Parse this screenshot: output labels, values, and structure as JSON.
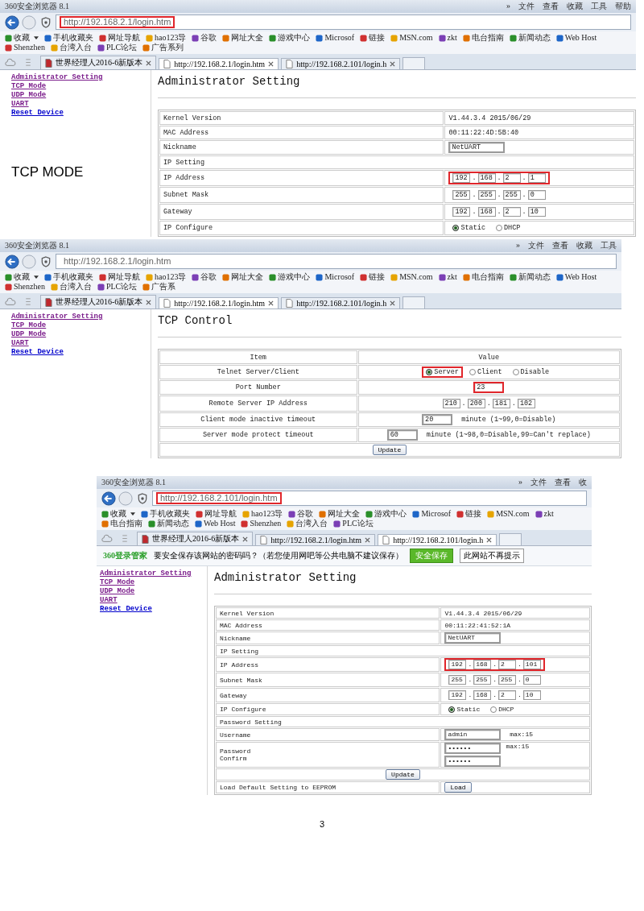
{
  "panels": [
    {
      "browser": {
        "title": "360安全浏览器 8.1",
        "menu": [
          "»",
          "文件",
          "查看",
          "收藏",
          "工具",
          "帮助"
        ],
        "url": "http://192.168.2.1/login.htm",
        "url_highlighted": true,
        "bookmarks": [
          "收藏",
          "手机收藏夹",
          "网址导航",
          "hao123导",
          "谷歌",
          "网址大全",
          "游戏中心",
          "Microsof",
          "链接",
          "MSN.com",
          "zkt",
          "电台指南",
          "新闻动态",
          "Web Host",
          "Shenzhen",
          "台湾入台",
          "PLC论坛",
          "广告系列"
        ],
        "tabs": [
          {
            "label": "世界经理人2016-6新版本",
            "selected": false
          },
          {
            "label": "http://192.168.2.1/login.htm",
            "selected": true
          },
          {
            "label": "http://192.168.2.101/login.h",
            "selected": false
          }
        ]
      },
      "sidebar": [
        {
          "label": "Administrator Setting",
          "visited": true
        },
        {
          "label": "TCP Mode",
          "visited": true
        },
        {
          "label": "UDP Mode",
          "visited": true
        },
        {
          "label": "UART",
          "visited": true
        },
        {
          "label": "Reset Device",
          "visited": false
        }
      ],
      "caption": "TCP MODE",
      "page": {
        "title": "Administrator Setting",
        "rows": [
          {
            "kind": "text",
            "label": "Kernel Version",
            "value": "V1.44.3.4 2015/06/29"
          },
          {
            "kind": "text",
            "label": "MAC Address",
            "value": "00:11:22:4D:5B:40"
          },
          {
            "kind": "input",
            "label": "Nickname",
            "value": "NetUART"
          },
          {
            "kind": "section",
            "label": "IP Setting"
          },
          {
            "kind": "ip",
            "label": "IP Address",
            "octets": [
              "192",
              "168",
              "2",
              "1"
            ],
            "separator": ".",
            "highlighted": true
          },
          {
            "kind": "ip",
            "label": "Subnet Mask",
            "octets": [
              "255",
              "255",
              "255",
              "0"
            ],
            "separator": ".",
            "highlighted": false
          },
          {
            "kind": "ip",
            "label": "Gateway",
            "octets": [
              "192",
              "168",
              "2",
              "10"
            ],
            "separator": ".",
            "highlighted": false
          },
          {
            "kind": "radio",
            "label": "IP Configure",
            "options": [
              {
                "label": "Static",
                "selected": true,
                "highlighted": false
              },
              {
                "label": "DHCP",
                "selected": false,
                "highlighted": false
              }
            ]
          }
        ]
      }
    },
    {
      "browser": {
        "title": "360安全浏览器 8.1",
        "menu": [
          "»",
          "文件",
          "查看",
          "收藏",
          "工具"
        ],
        "url": "http://192.168.2.1/login.htm",
        "url_highlighted": false,
        "bookmarks": [
          "收藏",
          "手机收藏夹",
          "网址导航",
          "hao123导",
          "谷歌",
          "网址大全",
          "游戏中心",
          "Microsof",
          "链接",
          "MSN.com",
          "zkt",
          "电台指南",
          "新闻动态",
          "Web Host",
          "Shenzhen",
          "台湾入台",
          "PLC论坛",
          "广告系"
        ],
        "tabs": [
          {
            "label": "世界经理人2016-6新版本",
            "selected": false
          },
          {
            "label": "http://192.168.2.1/login.htm",
            "selected": true
          },
          {
            "label": "http://192.168.2.101/login.h",
            "selected": false
          }
        ]
      },
      "sidebar": [
        {
          "label": "Administrator Setting",
          "visited": true
        },
        {
          "label": "TCP Mode",
          "visited": true
        },
        {
          "label": "UDP Mode",
          "visited": true
        },
        {
          "label": "UART",
          "visited": true
        },
        {
          "label": "Reset Device",
          "visited": false
        }
      ],
      "page": {
        "title": "TCP Control",
        "header": [
          "Item",
          "Value"
        ],
        "rows": [
          {
            "kind": "radio",
            "label": "Telnet Server/Client",
            "options": [
              {
                "label": "Server",
                "selected": true,
                "highlighted": true
              },
              {
                "label": "Client",
                "selected": false,
                "highlighted": false
              },
              {
                "label": "Disable",
                "selected": false,
                "highlighted": false
              }
            ]
          },
          {
            "kind": "input",
            "label": "Port Number",
            "value": "23",
            "highlighted": true
          },
          {
            "kind": "ip",
            "label": "Remote Server IP Address",
            "octets": [
              "210",
              "200",
              "181",
              "102"
            ],
            "separator": ".",
            "highlighted": false
          },
          {
            "kind": "input",
            "label": "Client mode inactive timeout",
            "value": "20",
            "suffix": "minute (1~99,0=Disable)",
            "highlighted": false
          },
          {
            "kind": "input",
            "label": "Server mode protect timeout",
            "value": "60",
            "suffix": "minute (1~98,0=Disable,99=Can't replace)",
            "highlighted": false
          },
          {
            "kind": "button",
            "label": "Update"
          }
        ]
      }
    },
    {
      "browser": {
        "title": "360安全浏览器 8.1",
        "menu": [
          "»",
          "文件",
          "查看",
          "收"
        ],
        "url": "http://192.168.2.101/login.htm",
        "url_highlighted": true,
        "bookmarks": [
          "收藏",
          "手机收藏夹",
          "网址导航",
          "hao123导",
          "谷歌",
          "网址大全",
          "游戏中心",
          "Microsof",
          "链接",
          "MSN.com",
          "zkt",
          "电台指南",
          "新闻动态",
          "Web Host",
          "Shenzhen",
          "台湾入台",
          "PLC论坛"
        ],
        "tabs": [
          {
            "label": "世界经理人2016-6新版本",
            "selected": false
          },
          {
            "label": "http://192.168.2.1/login.htm",
            "selected": false
          },
          {
            "label": "http://192.168.2.101/login.h",
            "selected": true
          }
        ]
      },
      "password_prompt": {
        "brand": "360登录管家",
        "message": "要安全保存该网站的密码吗？（若您使用网吧等公共电脑不建议保存）",
        "save": "安全保存",
        "dismiss": "此网站不再提示"
      },
      "sidebar": [
        {
          "label": "Administrator Setting",
          "visited": true
        },
        {
          "label": "TCP Mode",
          "visited": true
        },
        {
          "label": "UDP Mode",
          "visited": true
        },
        {
          "label": "UART",
          "visited": true
        },
        {
          "label": "Reset Device",
          "visited": false
        }
      ],
      "page": {
        "title": "Administrator Setting",
        "rows": [
          {
            "kind": "text",
            "label": "Kernel Version",
            "value": "V1.44.3.4 2015/06/29"
          },
          {
            "kind": "text",
            "label": "MAC Address",
            "value": "00:11:22:41:52:1A"
          },
          {
            "kind": "input",
            "label": "Nickname",
            "value": "NetUART"
          },
          {
            "kind": "section",
            "label": "IP Setting"
          },
          {
            "kind": "ip",
            "label": "IP Address",
            "octets": [
              "192",
              "168",
              "2",
              "101"
            ],
            "separator": ".",
            "highlighted": true
          },
          {
            "kind": "ip",
            "label": "Subnet Mask",
            "octets": [
              "255",
              "255",
              "255",
              "0"
            ],
            "separator": ".",
            "highlighted": false
          },
          {
            "kind": "ip",
            "label": "Gateway",
            "octets": [
              "192",
              "168",
              "2",
              "10"
            ],
            "separator": ".",
            "highlighted": false
          },
          {
            "kind": "radio",
            "label": "IP Configure",
            "options": [
              {
                "label": "Static",
                "selected": true,
                "highlighted": false
              },
              {
                "label": "DHCP",
                "selected": false,
                "highlighted": false
              }
            ]
          },
          {
            "kind": "section",
            "label": "Password Setting"
          },
          {
            "kind": "input",
            "label": "Username",
            "value": "admin",
            "suffix": "max:15",
            "highlighted": false
          },
          {
            "kind": "password",
            "labels": [
              "Password",
              "Confirm"
            ],
            "values": [
              "••••••",
              "••••••"
            ],
            "suffix": "max:15"
          },
          {
            "kind": "button",
            "label": "Update"
          },
          {
            "kind": "action",
            "label": "Load Default Setting to EEPROM",
            "button": "Load"
          }
        ]
      }
    }
  ],
  "page_number": "3"
}
